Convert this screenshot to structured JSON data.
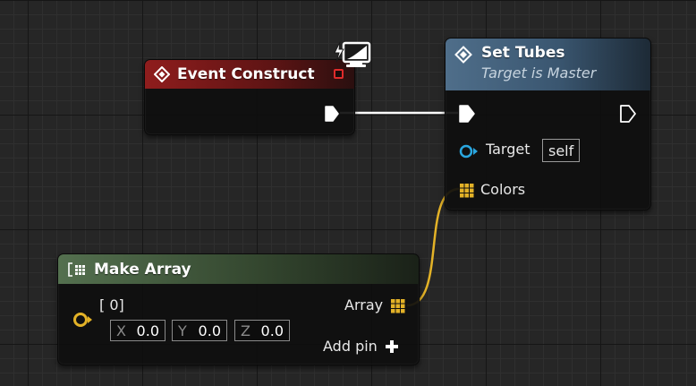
{
  "colors": {
    "event_header": "#8f1d1d",
    "function_header": "#4f6e8a",
    "make_array_header": "#54704f",
    "exec_wire": "#ffffff",
    "array_wire": "#e3b227",
    "object_pin": "#2aa7e0",
    "array_pin": "#e3b227",
    "vector_pin": "#e3b227"
  },
  "event_construct": {
    "title": "Event Construct",
    "header_icon": "event-diamond-icon",
    "badge_icon": "replication-monitor-icon"
  },
  "set_tubes": {
    "title": "Set Tubes",
    "subtitle": "Target is Master",
    "header_icon": "function-icon",
    "target_label": "Target",
    "target_default": "self",
    "colors_label": "Colors"
  },
  "make_array": {
    "title": "Make Array",
    "header_icon": "make-array-icon",
    "element_label": "[ 0]",
    "vector": {
      "x_axis": "X",
      "x_value": "0.0",
      "y_axis": "Y",
      "y_value": "0.0",
      "z_axis": "Z",
      "z_value": "0.0"
    },
    "array_label": "Array",
    "add_pin_label": "Add pin"
  }
}
